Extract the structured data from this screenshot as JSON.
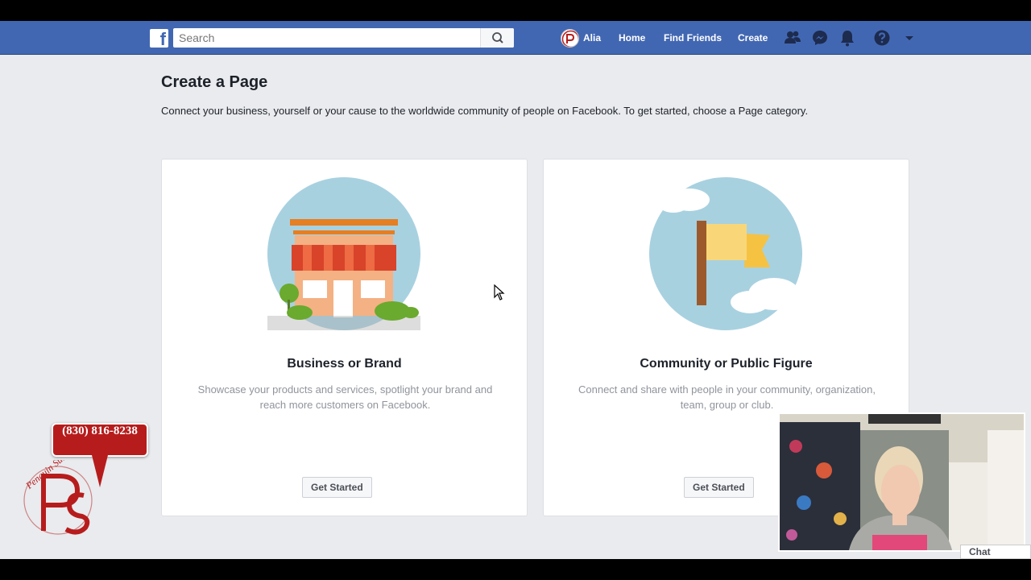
{
  "topbar": {
    "logo_letter": "f",
    "search_placeholder": "Search",
    "user_name": "Alia",
    "nav_links": [
      "Home",
      "Find Friends",
      "Create"
    ]
  },
  "page": {
    "title": "Create a Page",
    "subtitle": "Connect your business, yourself or your cause to the worldwide community of people on Facebook. To get started, choose a Page category."
  },
  "cards": [
    {
      "title": "Business or Brand",
      "description": "Showcase your products and services, spotlight your brand and reach more customers on Facebook.",
      "button": "Get Started"
    },
    {
      "title": "Community or Public Figure",
      "description": "Connect and share with people in your community, organization, team, group or club.",
      "button": "Get Started"
    }
  ],
  "overlay": {
    "phone": "(830) 816-8238",
    "logo_text": "Penguin Suits",
    "chat_label": "Chat"
  },
  "colors": {
    "brand_blue": "#4267b2",
    "page_bg": "#e9ebee",
    "badge_red": "#b71c1c"
  }
}
